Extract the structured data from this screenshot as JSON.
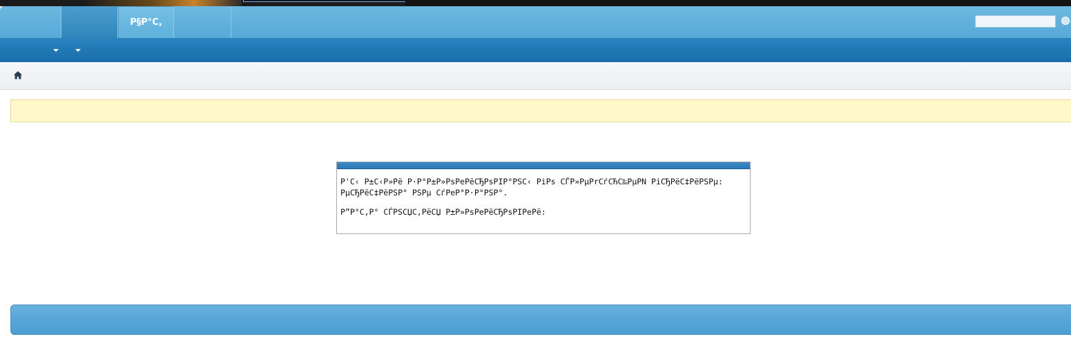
{
  "nav": {
    "tabs": [
      {
        "label": ""
      },
      {
        "label": ""
      },
      {
        "label": "P§P°C,"
      },
      {
        "label": ""
      }
    ],
    "search": {
      "placeholder": ""
    },
    "search_icon": "search-icon"
  },
  "subnav": {
    "dropdowns": [
      {
        "icon": "chevron-down-icon"
      },
      {
        "icon": "chevron-down-icon"
      }
    ]
  },
  "breadcrumb": {
    "icon": "home-icon"
  },
  "notice": {
    "text": ""
  },
  "error_box": {
    "line1": "P'C‹ P±C‹P»Pë P·P°P±P»PsPePëCЂPsPIP°PSC‹ PiPs CЃP»PµPrCѓCЋC‰PµPN PiCЂPëC‡PëPSPµ: PµCЂPëC‡PëPSP° PSPµ CѓPeP°P·P°PSP°.",
    "line2": "P”P°C,P° CЃPSCЏC,PëCЏ P±P»PsPePëCЂPsPIPePë:"
  },
  "colors": {
    "nav_top": "#6cb8e0",
    "subnav": "#186ea8",
    "notice_bg": "#fff8c9",
    "footer": "#4d9dd0"
  }
}
